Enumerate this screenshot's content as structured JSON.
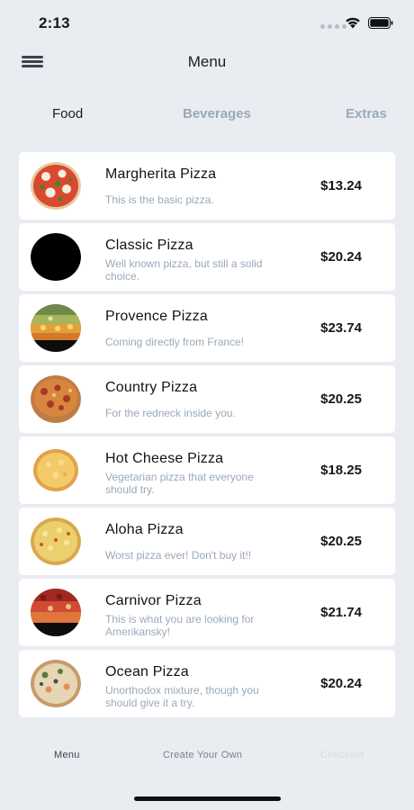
{
  "status": {
    "time": "2:13",
    "icons": [
      "signal-dots-icon",
      "wifi-icon",
      "battery-icon"
    ]
  },
  "header": {
    "title": "Menu",
    "menu_icon": "hamburger-icon"
  },
  "tabs": [
    {
      "label": "Food",
      "active": true
    },
    {
      "label": "Beverages",
      "active": false
    },
    {
      "label": "Extras",
      "active": false
    }
  ],
  "items": [
    {
      "name": "Margherita Pizza",
      "description": "This is the basic pizza.",
      "price": "$13.24"
    },
    {
      "name": "Classic Pizza",
      "description": "Well known pizza, but still a solid choice.",
      "price": "$20.24"
    },
    {
      "name": "Provence Pizza",
      "description": "Coming directly from France!",
      "price": "$23.74"
    },
    {
      "name": "Country Pizza",
      "description": "For the redneck inside you.",
      "price": "$20.25"
    },
    {
      "name": "Hot Cheese Pizza",
      "description": "Vegetarian pizza that everyone should try.",
      "price": "$18.25"
    },
    {
      "name": "Aloha Pizza",
      "description": "Worst pizza ever! Don't buy it!!",
      "price": "$20.25"
    },
    {
      "name": "Carnivor Pizza",
      "description": "This is what you are looking for Amerikansky!",
      "price": "$21.74"
    },
    {
      "name": "Ocean Pizza",
      "description": "Unorthodox mixture, though you should give it a try.",
      "price": "$20.24"
    }
  ],
  "bottom_nav": [
    {
      "label": "Menu"
    },
    {
      "label": "Create Your Own"
    },
    {
      "label": "Checkout"
    }
  ],
  "colors": {
    "background": "#e9edf2",
    "card": "#ffffff",
    "muted_text": "#9aa9b7",
    "primary_text": "#15171a"
  }
}
